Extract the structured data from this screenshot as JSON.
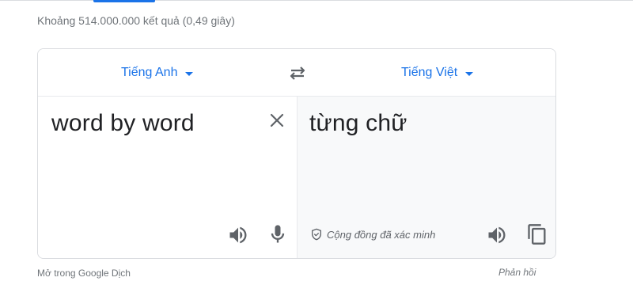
{
  "result_stats": "Khoảng 514.000.000 kết quả (0,49 giây)",
  "translator": {
    "source_language": "Tiếng Anh",
    "target_language": "Tiếng Việt",
    "source_text": "word by word",
    "translated_text": "từng chữ",
    "verified_label": "Cộng đồng đã xác minh"
  },
  "footer": {
    "open_in_translate": "Mở trong Google Dịch",
    "feedback": "Phản hồi"
  },
  "icons": {
    "swap": "swap-arrows-icon",
    "clear": "close-icon",
    "speaker": "speaker-icon",
    "mic": "microphone-icon",
    "copy": "copy-icon",
    "verified": "shield-check-icon"
  },
  "colors": {
    "accent": "#1a73e8",
    "icon": "#5f6368",
    "text": "#202124",
    "muted": "#70757a",
    "target_panel_bg": "#f8f9fa"
  }
}
